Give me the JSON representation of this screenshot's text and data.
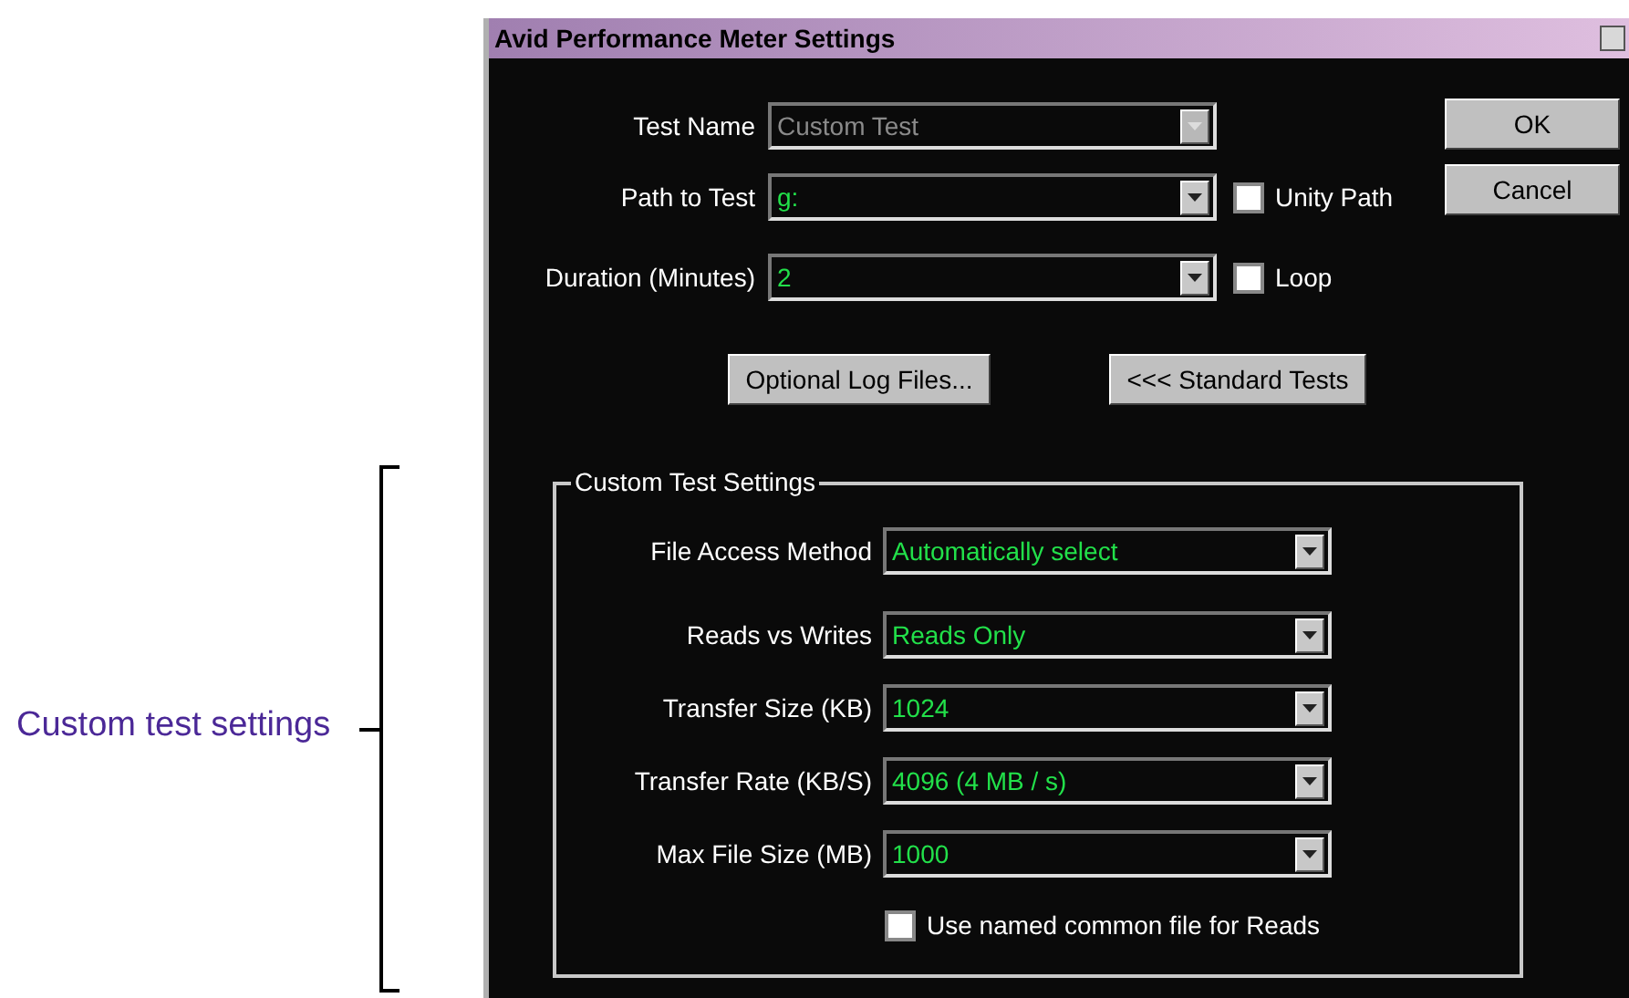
{
  "annotation": {
    "label": "Custom test settings"
  },
  "window": {
    "title": "Avid Performance Meter Settings"
  },
  "fields": [
    {
      "label": "Test Name",
      "value": "Custom Test",
      "disabled": true
    },
    {
      "label": "Path to Test",
      "value": "g:",
      "disabled": false,
      "checkbox": {
        "label": "Unity Path",
        "checked": false
      }
    },
    {
      "label": "Duration (Minutes)",
      "value": "2",
      "disabled": false,
      "checkbox": {
        "label": "Loop",
        "checked": false
      }
    }
  ],
  "dialog_buttons": [
    "OK",
    "Cancel"
  ],
  "action_buttons": [
    "Optional Log Files...",
    "<<< Standard Tests"
  ],
  "custom_test_settings": {
    "title": "Custom Test Settings",
    "fields": [
      {
        "label": "File Access Method",
        "value": "Automatically select"
      },
      {
        "label": "Reads vs Writes",
        "value": "Reads Only"
      },
      {
        "label": "Transfer Size (KB)",
        "value": "1024"
      },
      {
        "label": "Transfer Rate (KB/S)",
        "value": "4096 (4 MB / s)"
      },
      {
        "label": "Max File Size (MB)",
        "value": "1000"
      }
    ],
    "checkbox": {
      "label": "Use named common file for Reads",
      "checked": false
    }
  }
}
